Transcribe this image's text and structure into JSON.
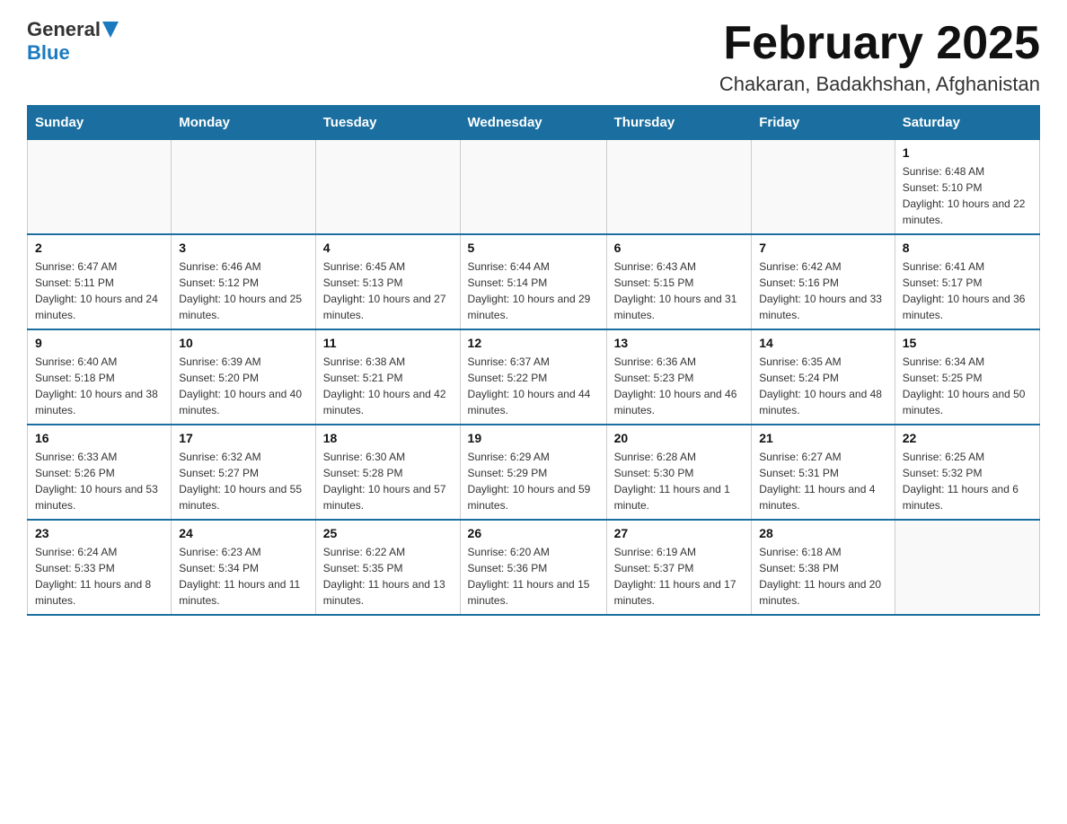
{
  "header": {
    "logo_general": "General",
    "logo_blue": "Blue",
    "title": "February 2025",
    "subtitle": "Chakaran, Badakhshan, Afghanistan"
  },
  "calendar": {
    "days_of_week": [
      "Sunday",
      "Monday",
      "Tuesday",
      "Wednesday",
      "Thursday",
      "Friday",
      "Saturday"
    ],
    "weeks": [
      {
        "days": [
          {
            "date": "",
            "info": ""
          },
          {
            "date": "",
            "info": ""
          },
          {
            "date": "",
            "info": ""
          },
          {
            "date": "",
            "info": ""
          },
          {
            "date": "",
            "info": ""
          },
          {
            "date": "",
            "info": ""
          },
          {
            "date": "1",
            "info": "Sunrise: 6:48 AM\nSunset: 5:10 PM\nDaylight: 10 hours and 22 minutes."
          }
        ]
      },
      {
        "days": [
          {
            "date": "2",
            "info": "Sunrise: 6:47 AM\nSunset: 5:11 PM\nDaylight: 10 hours and 24 minutes."
          },
          {
            "date": "3",
            "info": "Sunrise: 6:46 AM\nSunset: 5:12 PM\nDaylight: 10 hours and 25 minutes."
          },
          {
            "date": "4",
            "info": "Sunrise: 6:45 AM\nSunset: 5:13 PM\nDaylight: 10 hours and 27 minutes."
          },
          {
            "date": "5",
            "info": "Sunrise: 6:44 AM\nSunset: 5:14 PM\nDaylight: 10 hours and 29 minutes."
          },
          {
            "date": "6",
            "info": "Sunrise: 6:43 AM\nSunset: 5:15 PM\nDaylight: 10 hours and 31 minutes."
          },
          {
            "date": "7",
            "info": "Sunrise: 6:42 AM\nSunset: 5:16 PM\nDaylight: 10 hours and 33 minutes."
          },
          {
            "date": "8",
            "info": "Sunrise: 6:41 AM\nSunset: 5:17 PM\nDaylight: 10 hours and 36 minutes."
          }
        ]
      },
      {
        "days": [
          {
            "date": "9",
            "info": "Sunrise: 6:40 AM\nSunset: 5:18 PM\nDaylight: 10 hours and 38 minutes."
          },
          {
            "date": "10",
            "info": "Sunrise: 6:39 AM\nSunset: 5:20 PM\nDaylight: 10 hours and 40 minutes."
          },
          {
            "date": "11",
            "info": "Sunrise: 6:38 AM\nSunset: 5:21 PM\nDaylight: 10 hours and 42 minutes."
          },
          {
            "date": "12",
            "info": "Sunrise: 6:37 AM\nSunset: 5:22 PM\nDaylight: 10 hours and 44 minutes."
          },
          {
            "date": "13",
            "info": "Sunrise: 6:36 AM\nSunset: 5:23 PM\nDaylight: 10 hours and 46 minutes."
          },
          {
            "date": "14",
            "info": "Sunrise: 6:35 AM\nSunset: 5:24 PM\nDaylight: 10 hours and 48 minutes."
          },
          {
            "date": "15",
            "info": "Sunrise: 6:34 AM\nSunset: 5:25 PM\nDaylight: 10 hours and 50 minutes."
          }
        ]
      },
      {
        "days": [
          {
            "date": "16",
            "info": "Sunrise: 6:33 AM\nSunset: 5:26 PM\nDaylight: 10 hours and 53 minutes."
          },
          {
            "date": "17",
            "info": "Sunrise: 6:32 AM\nSunset: 5:27 PM\nDaylight: 10 hours and 55 minutes."
          },
          {
            "date": "18",
            "info": "Sunrise: 6:30 AM\nSunset: 5:28 PM\nDaylight: 10 hours and 57 minutes."
          },
          {
            "date": "19",
            "info": "Sunrise: 6:29 AM\nSunset: 5:29 PM\nDaylight: 10 hours and 59 minutes."
          },
          {
            "date": "20",
            "info": "Sunrise: 6:28 AM\nSunset: 5:30 PM\nDaylight: 11 hours and 1 minute."
          },
          {
            "date": "21",
            "info": "Sunrise: 6:27 AM\nSunset: 5:31 PM\nDaylight: 11 hours and 4 minutes."
          },
          {
            "date": "22",
            "info": "Sunrise: 6:25 AM\nSunset: 5:32 PM\nDaylight: 11 hours and 6 minutes."
          }
        ]
      },
      {
        "days": [
          {
            "date": "23",
            "info": "Sunrise: 6:24 AM\nSunset: 5:33 PM\nDaylight: 11 hours and 8 minutes."
          },
          {
            "date": "24",
            "info": "Sunrise: 6:23 AM\nSunset: 5:34 PM\nDaylight: 11 hours and 11 minutes."
          },
          {
            "date": "25",
            "info": "Sunrise: 6:22 AM\nSunset: 5:35 PM\nDaylight: 11 hours and 13 minutes."
          },
          {
            "date": "26",
            "info": "Sunrise: 6:20 AM\nSunset: 5:36 PM\nDaylight: 11 hours and 15 minutes."
          },
          {
            "date": "27",
            "info": "Sunrise: 6:19 AM\nSunset: 5:37 PM\nDaylight: 11 hours and 17 minutes."
          },
          {
            "date": "28",
            "info": "Sunrise: 6:18 AM\nSunset: 5:38 PM\nDaylight: 11 hours and 20 minutes."
          },
          {
            "date": "",
            "info": ""
          }
        ]
      }
    ]
  }
}
